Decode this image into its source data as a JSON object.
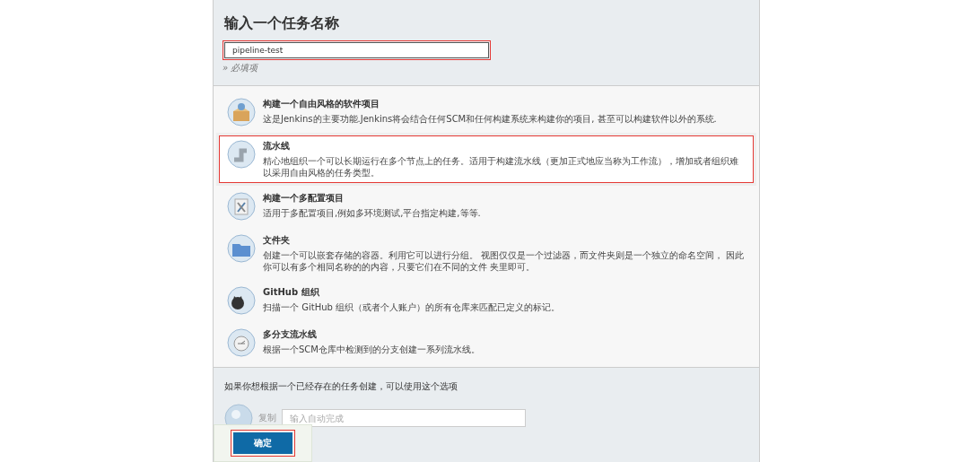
{
  "name_section": {
    "title": "输入一个任务名称",
    "field": {
      "value": "pipeline-test",
      "annotated": true
    },
    "hint": "» 必填项"
  },
  "job_types": [
    {
      "kind": "freestyle",
      "title": "构建一个自由风格的软件项目",
      "description": "这是Jenkins的主要功能.Jenkins将会结合任何SCM和任何构建系统来构建你的项目, 甚至可以构建软件以外的系统.",
      "selected": false
    },
    {
      "kind": "pipeline",
      "title": "流水线",
      "description": "精心地组织一个可以长期运行在多个节点上的任务。适用于构建流水线（更加正式地应当称为工作流），增加或者组织难以采用自由风格的任务类型。",
      "selected": true
    },
    {
      "kind": "matrix",
      "title": "构建一个多配置项目",
      "description": "适用于多配置项目,例如多环境测试,平台指定构建,等等.",
      "selected": false
    },
    {
      "kind": "folder",
      "title": "文件夹",
      "description": "创建一个可以嵌套存储的容器。利用它可以进行分组。 视图仅仅是一个过滤器，而文件夹则是一个独立的命名空间， 因此你可以有多个相同名称的的内容，只要它们在不同的文件 夹里即可。",
      "selected": false
    },
    {
      "kind": "github",
      "title": "GitHub 组织",
      "description": "扫描一个 GitHub 组织（或者个人账户）的所有仓库来匹配已定义的标记。",
      "selected": false
    },
    {
      "kind": "multibranch",
      "title": "多分支流水线",
      "description": "根据一个SCM仓库中检测到的分支创建一系列流水线。",
      "selected": false
    }
  ],
  "copy_section": {
    "text": "如果你想根据一个已经存在的任务创建，可以使用这个选项",
    "label": "复制",
    "placeholder": "输入自动完成"
  },
  "ok_button": {
    "label": "确定",
    "annotated": true
  }
}
